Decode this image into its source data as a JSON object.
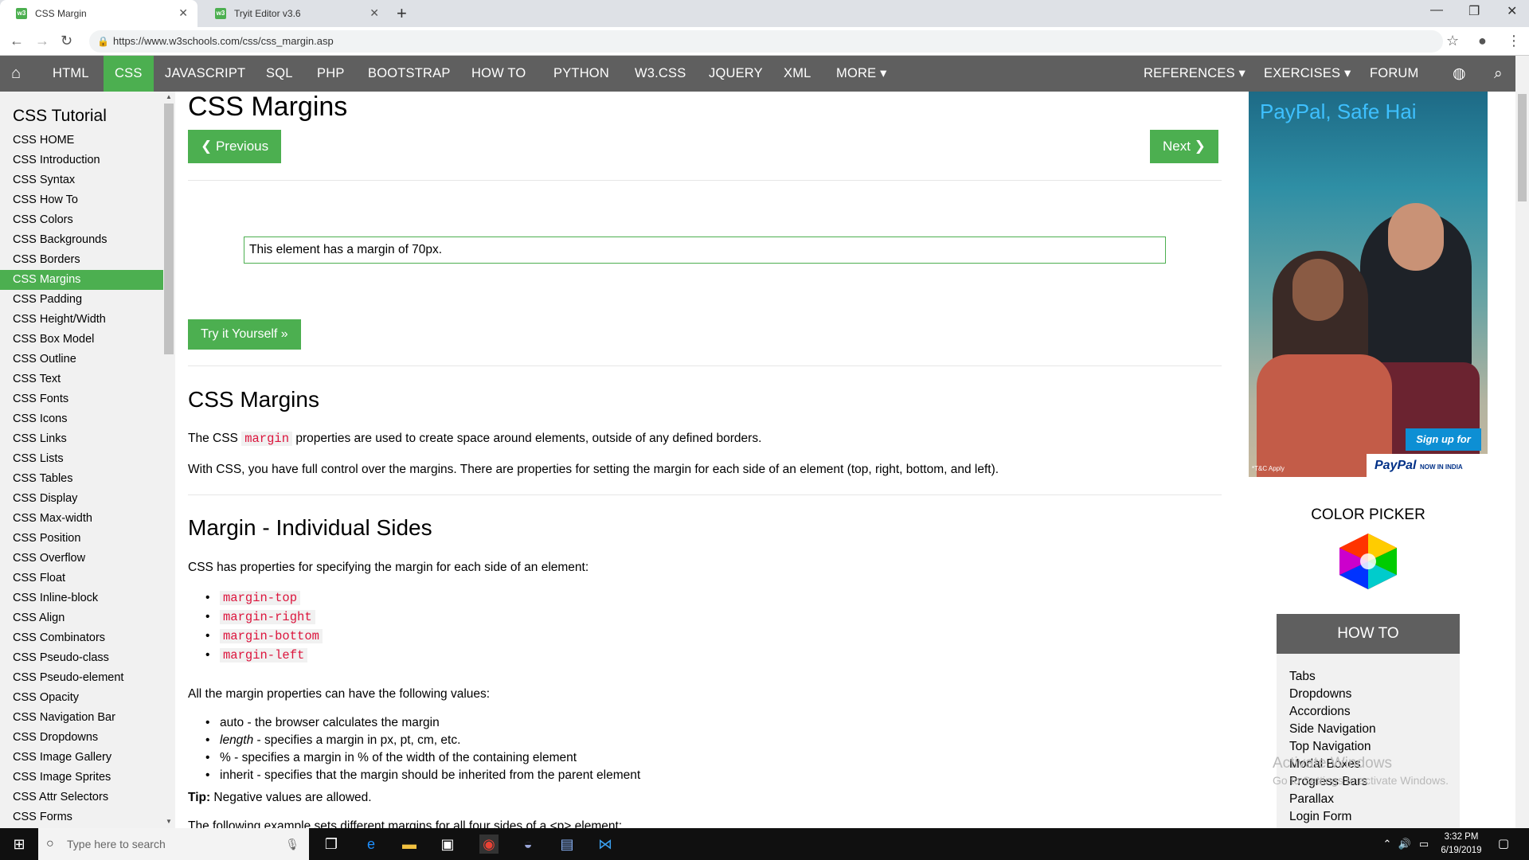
{
  "browser": {
    "tabs": [
      {
        "title": "CSS Margin",
        "favicon": "w3"
      },
      {
        "title": "Tryit Editor v3.6",
        "favicon": "w3"
      }
    ],
    "new_tab": "+",
    "url": "https://www.w3schools.com/css/css_margin.asp",
    "window_controls": [
      "minimize-icon",
      "restore-icon",
      "close-icon"
    ]
  },
  "topnav": {
    "home_icon": "home-icon",
    "items": [
      "HTML",
      "CSS",
      "JAVASCRIPT",
      "SQL",
      "PHP",
      "BOOTSTRAP",
      "HOW TO",
      "PYTHON",
      "W3.CSS",
      "JQUERY",
      "XML",
      "MORE ▾"
    ],
    "active": "CSS",
    "right_items": [
      "REFERENCES ▾",
      "EXERCISES ▾",
      "FORUM"
    ],
    "accent": "#4CAF50",
    "bar_color": "#5f5f5f"
  },
  "sidebar": {
    "title": "CSS Tutorial",
    "items": [
      "CSS HOME",
      "CSS Introduction",
      "CSS Syntax",
      "CSS How To",
      "CSS Colors",
      "CSS Backgrounds",
      "CSS Borders",
      "CSS Margins",
      "CSS Padding",
      "CSS Height/Width",
      "CSS Box Model",
      "CSS Outline",
      "CSS Text",
      "CSS Fonts",
      "CSS Icons",
      "CSS Links",
      "CSS Lists",
      "CSS Tables",
      "CSS Display",
      "CSS Max-width",
      "CSS Position",
      "CSS Overflow",
      "CSS Float",
      "CSS Inline-block",
      "CSS Align",
      "CSS Combinators",
      "CSS Pseudo-class",
      "CSS Pseudo-element",
      "CSS Opacity",
      "CSS Navigation Bar",
      "CSS Dropdowns",
      "CSS Image Gallery",
      "CSS Image Sprites",
      "CSS Attr Selectors",
      "CSS Forms"
    ],
    "active": "CSS Margins"
  },
  "main": {
    "title": "CSS Margins",
    "prev_label": "❮ Previous",
    "next_label": "Next ❯",
    "demo_text": "This element has a margin of 70px.",
    "try_label": "Try it Yourself »",
    "section1": {
      "heading": "CSS Margins",
      "p1_before": "The CSS ",
      "p1_code": "margin",
      "p1_after": " properties are used to create space around elements, outside of any defined borders.",
      "p2": "With CSS, you have full control over the margins. There are properties for setting the margin for each side of an element (top, right, bottom, and left)."
    },
    "section2": {
      "heading": "Margin - Individual Sides",
      "intro": "CSS has properties for specifying the margin for each side of an element:",
      "props": [
        "margin-top",
        "margin-right",
        "margin-bottom",
        "margin-left"
      ],
      "values_intro": "All the margin properties can have the following values:",
      "values": [
        {
          "term": "auto",
          "desc": " - the browser calculates the margin"
        },
        {
          "term": "length",
          "desc": " - specifies a margin in px, pt, cm, etc."
        },
        {
          "term": "%",
          "desc": " - specifies a margin in % of the width of the containing element"
        },
        {
          "term": "inherit",
          "desc": " - specifies that the margin should be inherited from the parent element"
        }
      ],
      "tip_label": "Tip:",
      "tip_text": " Negative values are allowed.",
      "cut_line": "The following example sets different margins for all four sides of a <p> element:"
    }
  },
  "ad": {
    "tagline": "PayPal, Safe Hai",
    "signup": "Sign up for Free",
    "brand": "PayPal",
    "brand_sub": "NOW IN INDIA",
    "tc": "*T&C Apply"
  },
  "color_picker": {
    "title": "COLOR PICKER"
  },
  "howto": {
    "title": "HOW TO",
    "items": [
      "Tabs",
      "Dropdowns",
      "Accordions",
      "Side Navigation",
      "Top Navigation",
      "Modal Boxes",
      "Progress Bars",
      "Parallax",
      "Login Form"
    ]
  },
  "watermark": {
    "line1": "Activate Windows",
    "line2": "Go to Settings to activate Windows."
  },
  "taskbar": {
    "search_placeholder": "Type here to search",
    "time": "3:32 PM",
    "date": "6/19/2019"
  }
}
